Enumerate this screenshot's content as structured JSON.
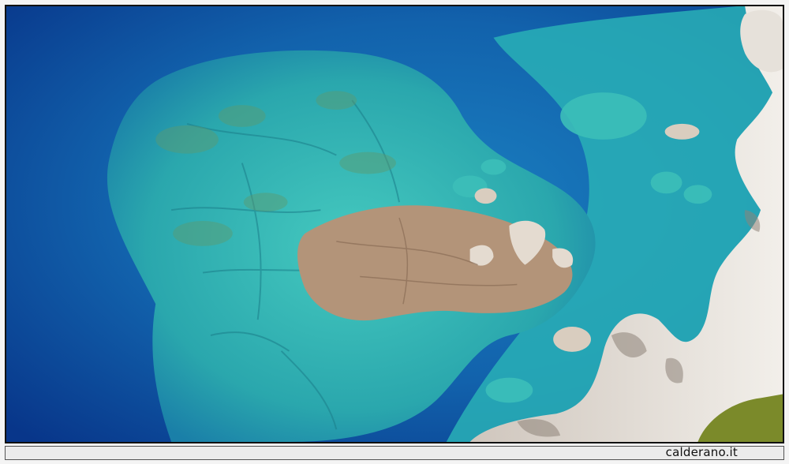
{
  "photo": {
    "description_colors": {
      "deep_sea": "#0a3d91",
      "mid_sea": "#1466b0",
      "shallow_water": "#2bb3b8",
      "turquoise": "#3fc7c0",
      "rock_tan": "#b89a7e",
      "rock_light": "#e7e2dc",
      "vegetation": "#7b8a2a"
    }
  },
  "footer": {
    "watermark": "calderano.it"
  }
}
